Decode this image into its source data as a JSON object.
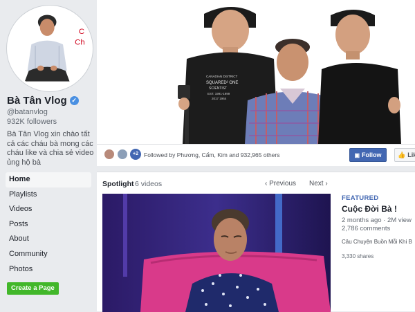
{
  "page": {
    "name": "Bà Tân Vlog",
    "handle": "@batanvlog",
    "followers": "932K followers",
    "about": "Bà Tân Vlog xin chào tất cả các cháu bà mong các cháu like và chia sẻ video ủng hộ bà"
  },
  "sidebar": {
    "items": [
      {
        "label": "Home",
        "active": true
      },
      {
        "label": "Playlists"
      },
      {
        "label": "Videos"
      },
      {
        "label": "Posts"
      },
      {
        "label": "About"
      },
      {
        "label": "Community"
      },
      {
        "label": "Photos"
      }
    ],
    "create_label": "Create a Page"
  },
  "cover": {
    "shirt_text": [
      "CANADIAN DISTRICT",
      "SQUARED² ONE",
      "SCIENTIST",
      "EST. 1991-1999",
      "2017 1964"
    ]
  },
  "follow_strip": {
    "plus_count": "+2",
    "followed_text": "Followed by Phương, Cẩm, Kim and 932,965 others",
    "follow_label": "Follow",
    "like_label": "Lik"
  },
  "spotlight": {
    "title": "Spotlight",
    "count": "6 videos",
    "previous": "Previous",
    "next": "Next"
  },
  "featured_video": {
    "badge": "FEATURED",
    "title": "Cuộc Đời Bà !",
    "meta": "2 months ago · 2M view",
    "comments": "2,786 comments",
    "description": "Câu Chuyện Buồn Mỗi Khi B",
    "shares": "3,330 shares"
  },
  "colors": {
    "brand_blue": "#4267b2",
    "create_green": "#42b72a",
    "featured_blue": "#4267b2",
    "avatar_red_text": "#d0021b"
  },
  "avatar_letters": [
    "C",
    "Ch"
  ]
}
